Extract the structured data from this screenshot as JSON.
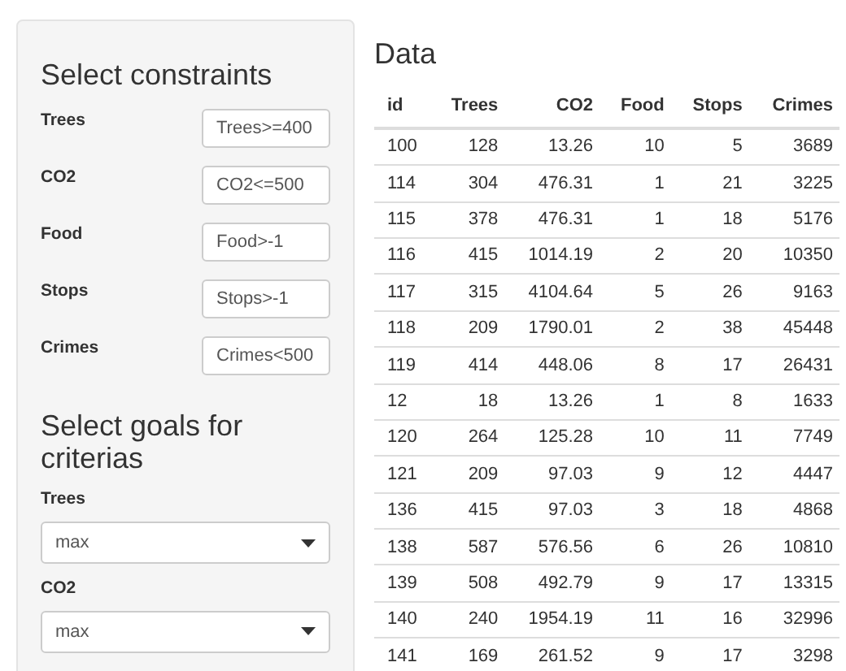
{
  "sidebar": {
    "constraints_title": "Select constraints",
    "constraints": [
      {
        "label": "Trees",
        "value": "Trees>=400"
      },
      {
        "label": "CO2",
        "value": "CO2<=500"
      },
      {
        "label": "Food",
        "value": "Food>-1"
      },
      {
        "label": "Stops",
        "value": "Stops>-1"
      },
      {
        "label": "Crimes",
        "value": "Crimes<500"
      }
    ],
    "goals_title": "Select goals for criterias",
    "goals": [
      {
        "label": "Trees",
        "value": "max"
      },
      {
        "label": "CO2",
        "value": "max"
      }
    ]
  },
  "table": {
    "title": "Data",
    "columns": [
      "id",
      "Trees",
      "CO2",
      "Food",
      "Stops",
      "Crimes"
    ],
    "rows": [
      [
        "100",
        "128",
        "13.26",
        "10",
        "5",
        "3689"
      ],
      [
        "114",
        "304",
        "476.31",
        "1",
        "21",
        "3225"
      ],
      [
        "115",
        "378",
        "476.31",
        "1",
        "18",
        "5176"
      ],
      [
        "116",
        "415",
        "1014.19",
        "2",
        "20",
        "10350"
      ],
      [
        "117",
        "315",
        "4104.64",
        "5",
        "26",
        "9163"
      ],
      [
        "118",
        "209",
        "1790.01",
        "2",
        "38",
        "45448"
      ],
      [
        "119",
        "414",
        "448.06",
        "8",
        "17",
        "26431"
      ],
      [
        "12",
        "18",
        "13.26",
        "1",
        "8",
        "1633"
      ],
      [
        "120",
        "264",
        "125.28",
        "10",
        "11",
        "7749"
      ],
      [
        "121",
        "209",
        "97.03",
        "9",
        "12",
        "4447"
      ],
      [
        "136",
        "415",
        "97.03",
        "3",
        "18",
        "4868"
      ],
      [
        "138",
        "587",
        "576.56",
        "6",
        "26",
        "10810"
      ],
      [
        "139",
        "508",
        "492.79",
        "9",
        "17",
        "13315"
      ],
      [
        "140",
        "240",
        "1954.19",
        "11",
        "16",
        "32996"
      ],
      [
        "141",
        "169",
        "261.52",
        "9",
        "17",
        "3298"
      ]
    ]
  }
}
